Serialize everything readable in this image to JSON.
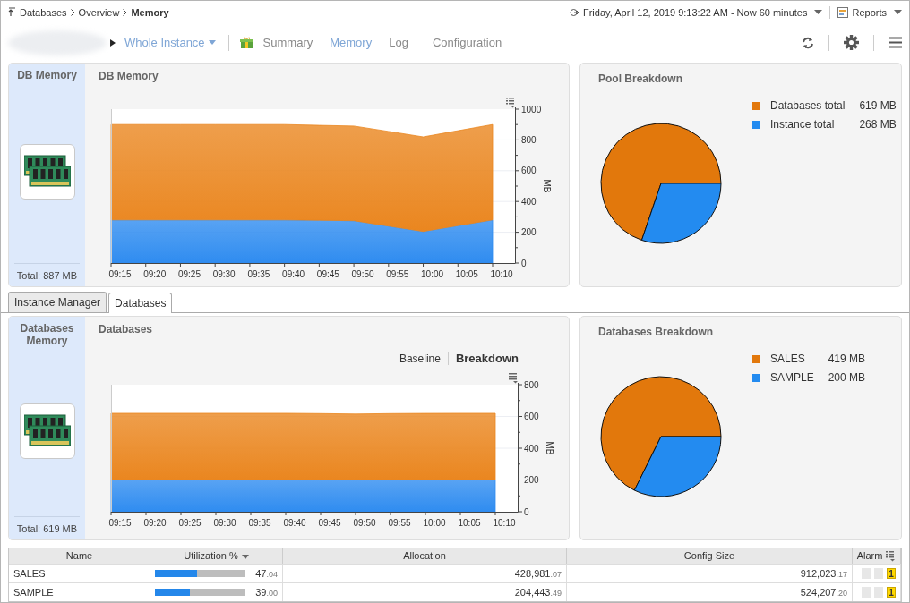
{
  "breadcrumb": [
    {
      "label": "Databases",
      "current": false
    },
    {
      "label": "Overview",
      "current": false
    },
    {
      "label": "Memory",
      "current": true
    }
  ],
  "time_range": "Friday, April 12, 2019 9:13:22 AM - Now 60 minutes",
  "reports": "Reports",
  "nav": {
    "scope": "Whole Instance",
    "items": [
      {
        "label": "Summary",
        "selected": false
      },
      {
        "label": "Memory",
        "selected": true
      },
      {
        "label": "Log",
        "selected": false
      },
      {
        "label": "Configuration",
        "selected": false
      }
    ]
  },
  "memory_panel": {
    "side_title": "DB Memory",
    "total": "Total: 887 MB",
    "title": "DB Memory",
    "chart_data": {
      "type": "area",
      "stacked": true,
      "grid": true,
      "ylabel": "MB",
      "categories": [
        "09:15",
        "09:20",
        "09:25",
        "09:30",
        "09:35",
        "09:40",
        "09:45",
        "09:50",
        "09:55",
        "10:00",
        "10:05",
        "10:10"
      ],
      "ylim": [
        0,
        1000
      ],
      "yticks": [
        0,
        200,
        400,
        600,
        800,
        1000
      ],
      "series": [
        {
          "color": "#2f8cf0",
          "values": [
            280,
            280,
            280,
            280,
            280,
            280,
            278,
            275,
            240,
            205,
            243,
            280
          ]
        },
        {
          "color": "#ea861f",
          "values": [
            620,
            620,
            620,
            620,
            620,
            620,
            617,
            615,
            615,
            615,
            617,
            620
          ]
        }
      ]
    }
  },
  "pool_breakdown": {
    "title": "Pool Breakdown",
    "legend": [
      {
        "value": "619 MB",
        "color": "#e2780c"
      },
      {
        "value": "268 MB",
        "color": "#238bf0"
      }
    ],
    "chart_data": {
      "type": "pie",
      "categories": [
        "Databases total",
        "Instance total"
      ],
      "values": [
        69.79,
        30.21
      ]
    }
  },
  "tabs": [
    {
      "label": "Instance Manager",
      "selected": false
    },
    {
      "label": "Databases",
      "selected": true
    }
  ],
  "databases_panel": {
    "side_title": "Databases Memory",
    "total": "Total: 619 MB",
    "title": "Databases",
    "views": [
      {
        "label": "Baseline",
        "selected": false
      },
      {
        "label": "Breakdown",
        "selected": true
      }
    ],
    "chart_data": {
      "type": "area",
      "stacked": true,
      "grid": true,
      "ylabel": "MB",
      "categories": [
        "09:15",
        "09:20",
        "09:25",
        "09:30",
        "09:35",
        "09:40",
        "09:45",
        "09:50",
        "09:55",
        "10:00",
        "10:05",
        "10:10"
      ],
      "ylim": [
        0,
        800
      ],
      "yticks": [
        0,
        200,
        400,
        600,
        800
      ],
      "series": [
        {
          "color": "#2f8cf0",
          "values": [
            200,
            200,
            200,
            200,
            200,
            200,
            200,
            200,
            200,
            200,
            200,
            200
          ]
        },
        {
          "color": "#ea861f",
          "values": [
            420,
            420,
            420,
            420,
            420,
            420,
            418,
            415,
            418,
            419,
            420,
            420
          ]
        }
      ]
    }
  },
  "databases_breakdown": {
    "title": "Databases Breakdown",
    "legend": [
      {
        "value": "419 MB",
        "color": "#e2780c"
      },
      {
        "value": "200 MB",
        "color": "#238bf0"
      }
    ],
    "chart_data": {
      "type": "pie",
      "categories": [
        "SALES",
        "SAMPLE"
      ],
      "values": [
        67.69,
        32.31
      ]
    }
  },
  "table": {
    "columns": [
      {
        "label": "Name",
        "sorted": false
      },
      {
        "label": "Utilization %",
        "sorted": true
      },
      {
        "label": "Allocation",
        "sorted": false
      },
      {
        "label": "Config Size",
        "sorted": false
      },
      {
        "label": "Alarm",
        "sorted": false
      }
    ],
    "rows": [
      {
        "name": "SALES",
        "utilization": "47.04",
        "level": 0.47,
        "allocation": "428,981.07",
        "config_size": "912,023.17",
        "alarm": "1"
      },
      {
        "name": "SAMPLE",
        "utilization": "39.00",
        "level": 0.39,
        "allocation": "204,443.49",
        "config_size": "524,207.20",
        "alarm": "1"
      }
    ]
  }
}
